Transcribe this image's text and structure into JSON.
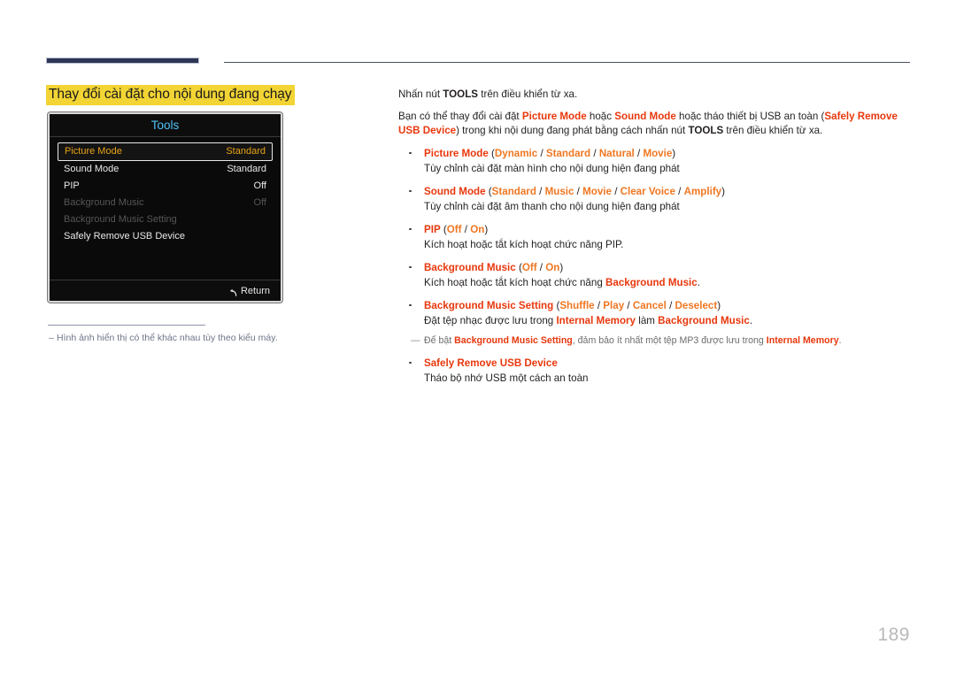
{
  "header": {
    "bar_color": "#2e3655",
    "rule_color": "#4a4f63"
  },
  "page_title": {
    "text": "Thay đổi cài đặt cho nội dung đang chạy",
    "highlight_color": "#f2d434"
  },
  "osd": {
    "title": "Tools",
    "title_color": "#4fc3f7",
    "selected_color": "#e8a317",
    "rows": [
      {
        "label": "Picture Mode",
        "value": "Standard",
        "state": "selected"
      },
      {
        "label": "Sound Mode",
        "value": "Standard",
        "state": "normal"
      },
      {
        "label": "PIP",
        "value": "Off",
        "state": "normal"
      },
      {
        "label": "Background Music",
        "value": "Off",
        "state": "disabled"
      },
      {
        "label": "Background Music Setting",
        "value": "",
        "state": "disabled"
      },
      {
        "label": "Safely Remove USB Device",
        "value": "",
        "state": "normal"
      }
    ],
    "footer": {
      "return_label": "Return",
      "return_icon": "return-arrow-icon"
    }
  },
  "left_footnote": {
    "dash": "–",
    "text": "Hình ảnh hiển thị có thể khác nhau tùy theo kiểu máy."
  },
  "body": {
    "lead_1": {
      "p1": "Nhấn nút ",
      "tools": "TOOLS",
      "p2": " trên điều khiển từ xa."
    },
    "lead_2": {
      "p1": "Bạn có thể thay đổi cài đặt ",
      "r1": "Picture Mode",
      "p2": " hoặc ",
      "r2": "Sound Mode",
      "p3": " hoặc tháo thiết bị USB an toàn (",
      "r3": "Safely Remove USB Device",
      "p4": ") trong khi nội dung đang phát bằng cách nhấn nút ",
      "tools": "TOOLS",
      "p5": " trên điều khiển từ xa."
    },
    "bullets": [
      {
        "name": "picture-mode",
        "head_term": "Picture Mode",
        "options": [
          "Dynamic",
          "Standard",
          "Natural",
          "Movie"
        ],
        "desc": "Tùy chỉnh cài đặt màn hình cho nội dung hiện đang phát"
      },
      {
        "name": "sound-mode",
        "head_term": "Sound Mode",
        "options": [
          "Standard",
          "Music",
          "Movie",
          "Clear Voice",
          "Amplify"
        ],
        "desc": "Tùy chỉnh cài đặt âm thanh cho nội dung hiện đang phát"
      },
      {
        "name": "pip",
        "head_term": "PIP",
        "options": [
          "Off",
          "On"
        ],
        "desc": "Kích hoạt hoặc tắt kích hoạt chức năng PIP."
      },
      {
        "name": "background-music",
        "head_term": "Background Music",
        "options": [
          "Off",
          "On"
        ],
        "desc_pre": "Kích hoạt hoặc tắt kích hoạt chức năng ",
        "desc_term": "Background Music",
        "desc_post": "."
      },
      {
        "name": "background-music-setting",
        "head_term": "Background Music Setting",
        "options": [
          "Shuffle",
          "Play",
          "Cancel",
          "Deselect"
        ],
        "desc_pre": "Đặt tệp nhạc được lưu trong ",
        "desc_term1": "Internal Memory",
        "desc_mid": " làm ",
        "desc_term2": "Background Music",
        "desc_post": "."
      },
      {
        "name": "safely-remove-usb-device",
        "head_term": "Safely Remove USB Device",
        "options": [],
        "desc": "Tháo bộ nhớ USB một cách an toàn"
      }
    ],
    "subnote": {
      "dash": "―",
      "p1": "Để bật ",
      "r1": "Background Music Setting",
      "p2": ", đảm bảo ít nhất một tệp MP3 được lưu trong ",
      "r2": "Internal Memory",
      "p3": "."
    }
  },
  "page_number": "189"
}
